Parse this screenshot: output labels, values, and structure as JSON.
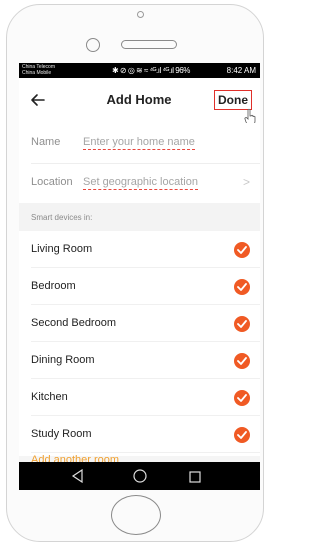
{
  "status_bar": {
    "carrier_line1": "China Telecom",
    "carrier_line2": "China Mobile",
    "icons_text": "✱ ⊘ ◎ ≋ ≈ ⁴ᴳ.ıl ⁴ᴳ.ıl 96%",
    "time": "8:42 AM"
  },
  "header": {
    "title": "Add Home",
    "done_label": "Done"
  },
  "form": {
    "name_label": "Name",
    "name_placeholder": "Enter your home name",
    "location_label": "Location",
    "location_value": "Set geographic location",
    "location_chevron": ">"
  },
  "section": {
    "title": "Smart devices in:"
  },
  "rooms": [
    {
      "label": "Living Room",
      "checked": true
    },
    {
      "label": "Bedroom",
      "checked": true
    },
    {
      "label": "Second Bedroom",
      "checked": true
    },
    {
      "label": "Dining Room",
      "checked": true
    },
    {
      "label": "Kitchen",
      "checked": true
    },
    {
      "label": "Study Room",
      "checked": true
    }
  ],
  "peek_item": {
    "label": "Add another room"
  },
  "colors": {
    "accent": "#f05a24",
    "highlight_box": "#e0302a",
    "navbar_bg": "#ffffff",
    "system_bar_bg": "#000000"
  },
  "icons": {
    "back": "arrow-left-icon",
    "check": "check-circle-icon",
    "sys_back": "triangle-back-icon",
    "sys_home": "circle-home-icon",
    "sys_recent": "square-recents-icon"
  }
}
